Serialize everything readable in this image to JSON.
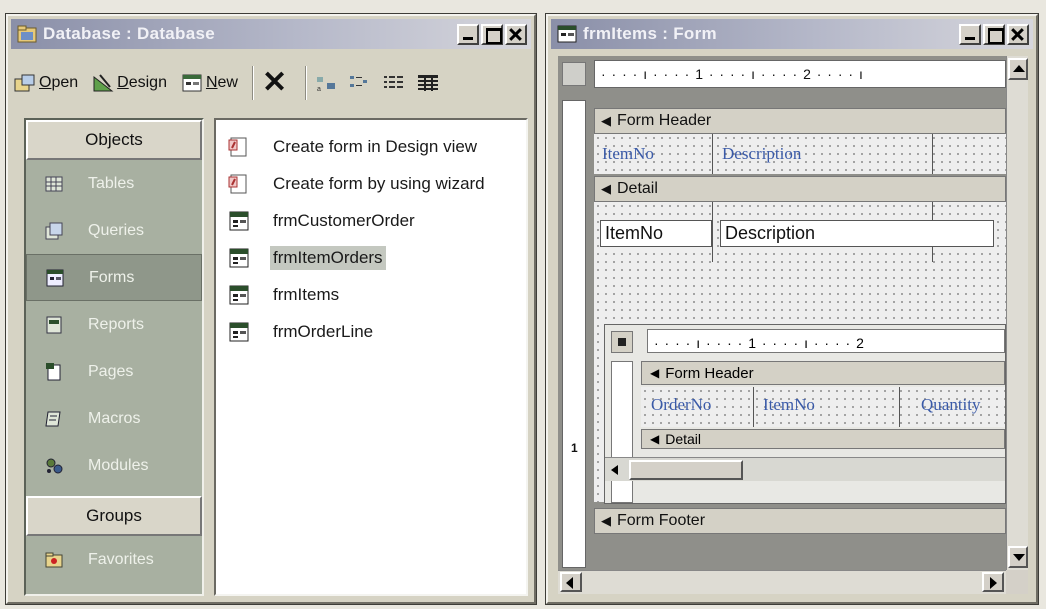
{
  "db_window": {
    "title": "Database : Database",
    "toolbar": {
      "open_prefix": "O",
      "open_rest": "pen",
      "design_prefix": "D",
      "design_rest": "esign",
      "new_prefix": "N",
      "new_rest": "ew",
      "delete_glyph": "✕"
    },
    "objects_header": "Objects",
    "objects": [
      {
        "label": "Tables",
        "icon": "table-icon"
      },
      {
        "label": "Queries",
        "icon": "query-icon"
      },
      {
        "label": "Forms",
        "icon": "form-icon",
        "selected": true
      },
      {
        "label": "Reports",
        "icon": "report-icon"
      },
      {
        "label": "Pages",
        "icon": "page-icon"
      },
      {
        "label": "Macros",
        "icon": "macro-icon"
      },
      {
        "label": "Modules",
        "icon": "module-icon"
      }
    ],
    "groups_header": "Groups",
    "favorites_label": "Favorites",
    "list_items": [
      {
        "label": "Create form in Design view",
        "icon": "wizard-icon"
      },
      {
        "label": "Create form by using wizard",
        "icon": "wizard-icon"
      },
      {
        "label": "frmCustomerOrder",
        "icon": "form-icon"
      },
      {
        "label": "frmItemOrders",
        "icon": "form-icon",
        "selected": true
      },
      {
        "label": "frmItems",
        "icon": "form-icon"
      },
      {
        "label": "frmOrderLine",
        "icon": "form-icon"
      }
    ]
  },
  "form_window": {
    "title": "frmItems : Form",
    "ruler_top": "· · · · ı · · · · 1 · · · · ı · · · · 2 · · · · ı",
    "ruler_left_mark": "1",
    "form_header_label": "Form Header",
    "header_labels": [
      "ItemNo",
      "Description"
    ],
    "detail_label": "Detail",
    "detail_fields": [
      "ItemNo",
      "Description"
    ],
    "subform": {
      "ruler_top": "· · · · ı · · · · 1 · · · · ı · · · · 2",
      "form_header_label": "Form Header",
      "header_labels": [
        "OrderNo",
        "ItemNo",
        "Quantity"
      ],
      "detail_label": "Detail"
    },
    "form_footer_label": "Form Footer"
  },
  "colors": {
    "title_gradient_start": "#8a8fa8",
    "objects_bar": "#a8b0a1",
    "header_label_text": "#3a5aa8"
  }
}
